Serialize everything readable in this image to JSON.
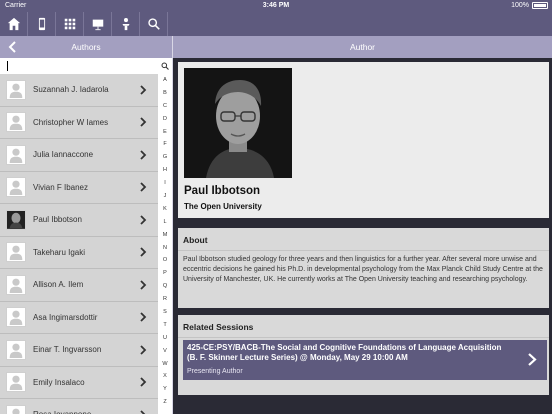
{
  "status_bar": {
    "carrier": "Carrier",
    "time": "3:46 PM",
    "battery": "100%"
  },
  "toolbar": {
    "buttons": [
      {
        "icon": "home-icon"
      },
      {
        "icon": "phone-icon"
      },
      {
        "icon": "grid-icon"
      },
      {
        "icon": "presentation-icon"
      },
      {
        "icon": "person-podium-icon"
      },
      {
        "icon": "search-icon"
      }
    ]
  },
  "left_panel": {
    "title": "Authors",
    "search": {
      "value": "",
      "placeholder": ""
    },
    "authors": [
      {
        "name": "Suzannah J. Iadarola",
        "avatar": "placeholder"
      },
      {
        "name": "Christopher W Iames",
        "avatar": "placeholder"
      },
      {
        "name": "Julia Iannaccone",
        "avatar": "placeholder"
      },
      {
        "name": "Vivian F Ibanez",
        "avatar": "placeholder"
      },
      {
        "name": "Paul Ibbotson",
        "avatar": "photo"
      },
      {
        "name": "Takeharu Igaki",
        "avatar": "placeholder"
      },
      {
        "name": "Allison A. Ilem",
        "avatar": "placeholder"
      },
      {
        "name": "Asa Ingimarsdottir",
        "avatar": "placeholder"
      },
      {
        "name": "Einar T. Ingvarsson",
        "avatar": "placeholder"
      },
      {
        "name": "Emily Insalaco",
        "avatar": "placeholder"
      },
      {
        "name": "Rosa Iovannone",
        "avatar": "placeholder"
      }
    ],
    "index": [
      "A",
      "B",
      "C",
      "D",
      "E",
      "F",
      "G",
      "H",
      "I",
      "J",
      "K",
      "L",
      "M",
      "N",
      "O",
      "P",
      "Q",
      "R",
      "S",
      "T",
      "U",
      "V",
      "W",
      "X",
      "Y",
      "Z"
    ]
  },
  "right_panel": {
    "title": "Author",
    "profile": {
      "name": "Paul Ibbotson",
      "affiliation": "The Open University"
    },
    "about": {
      "header": "About",
      "text": "Paul Ibbotson studied geology for three years and then linguistics for a further year. After several more unwise and eccentric decisions he gained his Ph.D. in developmental psychology from the Max Planck Child Study Centre at the University of Manchester, UK. He currently works at The Open University teaching and researching psychology."
    },
    "related": {
      "header": "Related Sessions",
      "sessions": [
        {
          "title": "425-CE:PSY/BACB-The Social and Cognitive Foundations of Language Acquisition (B. F. Skinner Lecture Series) @ Monday, May 29 10:00 AM",
          "role": "Presenting Author"
        }
      ]
    }
  },
  "colors": {
    "accent": "#5e5a7e",
    "nav": "#a39fc0",
    "background": "#2a2a35"
  }
}
